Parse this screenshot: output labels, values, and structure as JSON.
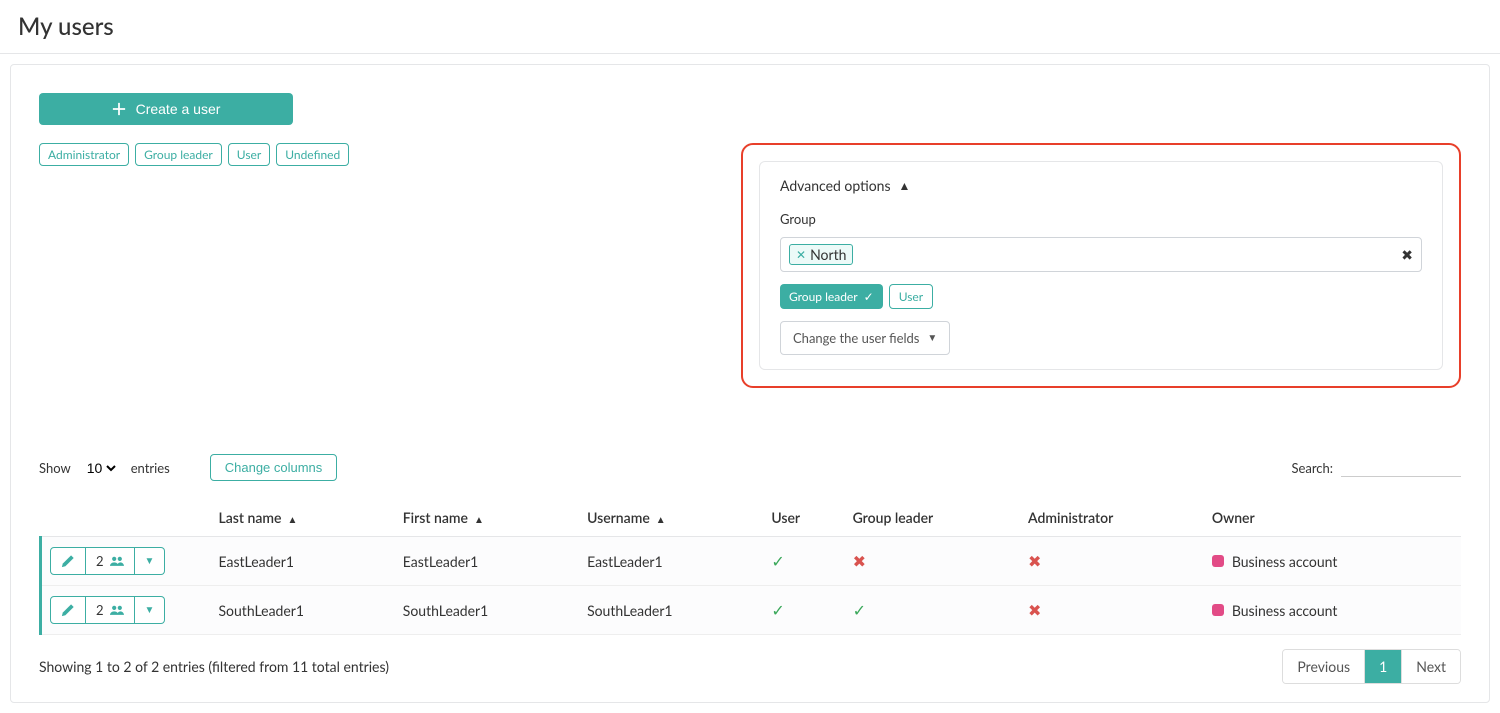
{
  "header": {
    "title": "My users"
  },
  "toolbar": {
    "create_user_label": "Create a user"
  },
  "filters": {
    "chips": [
      "Administrator",
      "Group leader",
      "User",
      "Undefined"
    ]
  },
  "advanced": {
    "title": "Advanced options",
    "group_label": "Group",
    "group_token": "North",
    "roles": {
      "group_leader_label": "Group leader",
      "user_label": "User"
    },
    "change_fields_label": "Change the user fields"
  },
  "table_controls": {
    "show_label": "Show",
    "length_value": "10",
    "entries_label": "entries",
    "change_columns_label": "Change columns",
    "search_label": "Search:"
  },
  "columns": {
    "last_name": "Last name",
    "first_name": "First name",
    "username": "Username",
    "user": "User",
    "group_leader": "Group leader",
    "administrator": "Administrator",
    "owner": "Owner"
  },
  "rows": [
    {
      "group_count": "2",
      "last_name": "EastLeader1",
      "first_name": "EastLeader1",
      "username": "EastLeader1",
      "user": true,
      "group_leader": false,
      "administrator": false,
      "owner": "Business account"
    },
    {
      "group_count": "2",
      "last_name": "SouthLeader1",
      "first_name": "SouthLeader1",
      "username": "SouthLeader1",
      "user": true,
      "group_leader": true,
      "administrator": false,
      "owner": "Business account"
    }
  ],
  "footer": {
    "info": "Showing 1 to 2 of 2 entries (filtered from 11 total entries)"
  },
  "paging": {
    "previous": "Previous",
    "next": "Next",
    "current": "1"
  },
  "colors": {
    "accent": "#3caea3",
    "danger": "#d9534f",
    "owner_swatch": "#e24b86",
    "callout": "#e83f2a"
  }
}
